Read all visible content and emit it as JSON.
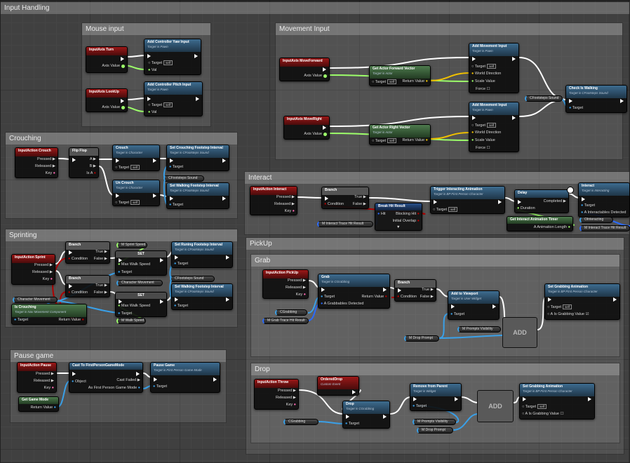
{
  "colors": {
    "exec": "#ffffff",
    "object": "#3aa0e8",
    "float": "#9dff6a",
    "bool": "#b00000",
    "vector": "#f0c000",
    "struct": "#2a6bff"
  },
  "comments": {
    "input_handling": "Input Handling",
    "mouse_input": "Mouse input",
    "movement_input": "Movement Input",
    "crouching": "Crouching",
    "sprinting": "Sprinting",
    "interact": "Interact",
    "pickup": "PickUp",
    "grab": "Grab",
    "drop": "Drop",
    "pause_game": "Pause game"
  },
  "mouse": {
    "turn_event": "InputAxis Turn",
    "lookup_event": "InputAxis LookUp",
    "axis_value": "Axis Value",
    "yaw_node": "Add Controller Yaw Input",
    "pitch_node": "Add Controller Pitch Input",
    "target_is_pawn": "Target is Pawn",
    "target": "Target",
    "self": "self",
    "val": "Val"
  },
  "movement": {
    "forward_event": "InputAxis MoveForward",
    "right_event": "InputAxis MoveRight",
    "axis_value": "Axis Value",
    "get_forward": "Get Actor Forward Vector",
    "get_right": "Get Actor Right Vector",
    "target_is_actor": "Target is Actor",
    "target": "Target",
    "self": "self",
    "return_value": "Return Value",
    "add_move": "Add Movement Input",
    "target_is_pawn": "Target is Pawn",
    "world_direction": "World Direction",
    "scale_value": "Scale Value",
    "force": "Force",
    "footsteps_var": "CFootsteps Sound",
    "check_walking": "Check Is Walking",
    "check_walking_sub": "Target is CFootsteps Sound"
  },
  "crouch": {
    "event": "InputAction Crouch",
    "pressed": "Pressed",
    "released": "Released",
    "key": "Key",
    "flipflop": "Flip Flop",
    "a": "A",
    "b": "B",
    "is_a": "Is A",
    "crouch_node": "Crouch",
    "uncrouch_node": "Un Crouch",
    "target_is_character": "Target is Character",
    "target": "Target",
    "self": "self",
    "set_crouch_int": "Set Crouching Footstep Interval",
    "set_walk_int": "Set Walking Footstep Interval",
    "target_is_footsteps": "Target is CFootsteps Sound",
    "footsteps_var": "CFootsteps Sound"
  },
  "sprint": {
    "event": "InputAction Sprint",
    "pressed": "Pressed",
    "released": "Released",
    "key": "Key",
    "branch": "Branch",
    "condition": "Condition",
    "true": "True",
    "false": "False",
    "sprint_speed": "M Sprint Speed",
    "walk_speed": "M Walk Speed",
    "set": "SET",
    "max_walk_speed": "Max Walk Speed",
    "target": "Target",
    "set_run_int": "Set Runing Footstep Interval",
    "set_walk_int": "Set Walking Footstep Interval",
    "target_is_footsteps": "Target is CFootsteps Sound",
    "footsteps_var": "CFootsteps Sound",
    "char_movement": "Character Movement",
    "is_crouching": "Is Crouching",
    "is_crouching_sub": "Target is Nav Movement Component",
    "return_value": "Return Value"
  },
  "pause": {
    "event": "InputAction Pause",
    "pressed": "Pressed",
    "released": "Released",
    "key": "Key",
    "cast": "Cast To FirstPersonGameMode",
    "object": "Object",
    "cast_failed": "Cast Failed",
    "as_gm": "As First Person Game Mode",
    "pause_node": "Pause Game",
    "pause_sub": "Target is First Person Game Mode",
    "target": "Target",
    "get_gm": "Get Game Mode",
    "return_value": "Return Value"
  },
  "interact": {
    "event": "InputAction Interact",
    "pressed": "Pressed",
    "released": "Released",
    "key": "Key",
    "branch": "Branch",
    "condition": "Condition",
    "true": "True",
    "false": "False",
    "break_hit": "Break Hit Result",
    "hit": "Hit",
    "blocking_hit": "Blocking Hit",
    "initial_overlap": "Initial Overlap",
    "trace_var": "M Interact Trace Hit Result",
    "trigger": "Trigger Interacting Animation",
    "trigger_sub": "Target is BP First Person Character",
    "target": "Target",
    "self": "self",
    "delay": "Delay",
    "completed": "Completed",
    "duration": "Duration",
    "get_timer": "Get Interact Animation Timer",
    "anim_length": "A Animation Length",
    "interact_node": "Interact",
    "interact_sub": "Target is Interacting",
    "interactables": "A Interactables Detected",
    "ointeracting": "OInteracting"
  },
  "grab": {
    "event": "InputAction PickUp",
    "pressed": "Pressed",
    "released": "Released",
    "key": "Key",
    "grab_node": "Grab",
    "grab_sub": "Target is CGrabbing",
    "target": "Target",
    "grabbables": "A Grabbables Detected",
    "return_value": "Return Value",
    "cgrabbing": "CGrabbing",
    "trace_var": "M Grab Trace Hit Result",
    "branch": "Branch",
    "condition": "Condition",
    "true": "True",
    "false": "False",
    "add_viewport": "Add to Viewport",
    "add_viewport_sub": "Target is User Widget",
    "prompts_vis": "M Prompts Visibility",
    "drop_prompt": "M Drop Prompt",
    "add_label": "ADD",
    "set_anim": "Set Grabbing Animation",
    "set_anim_sub": "Target is BP First Person Character",
    "self": "self",
    "is_grabbing": "A Is Grabbing Value"
  },
  "drop": {
    "event": "InputAction Throw",
    "pressed": "Pressed",
    "released": "Released",
    "key": "Key",
    "ordered": "OrderedDrop",
    "custom_event": "Custom Event",
    "drop_node": "Drop",
    "drop_sub": "Target is CGrabbing",
    "target": "Target",
    "cgrabbing": "CGrabbing",
    "remove": "Remove from Parent",
    "remove_sub": "Target is Widget",
    "prompts_vis": "M Prompts Visibility",
    "drop_prompt": "M Drop Prompt",
    "add_label": "ADD",
    "set_anim": "Set Grabbing Animation",
    "set_anim_sub": "Target is BP First Person Character",
    "self": "self",
    "is_grabbing": "A Is Grabbing Value"
  }
}
